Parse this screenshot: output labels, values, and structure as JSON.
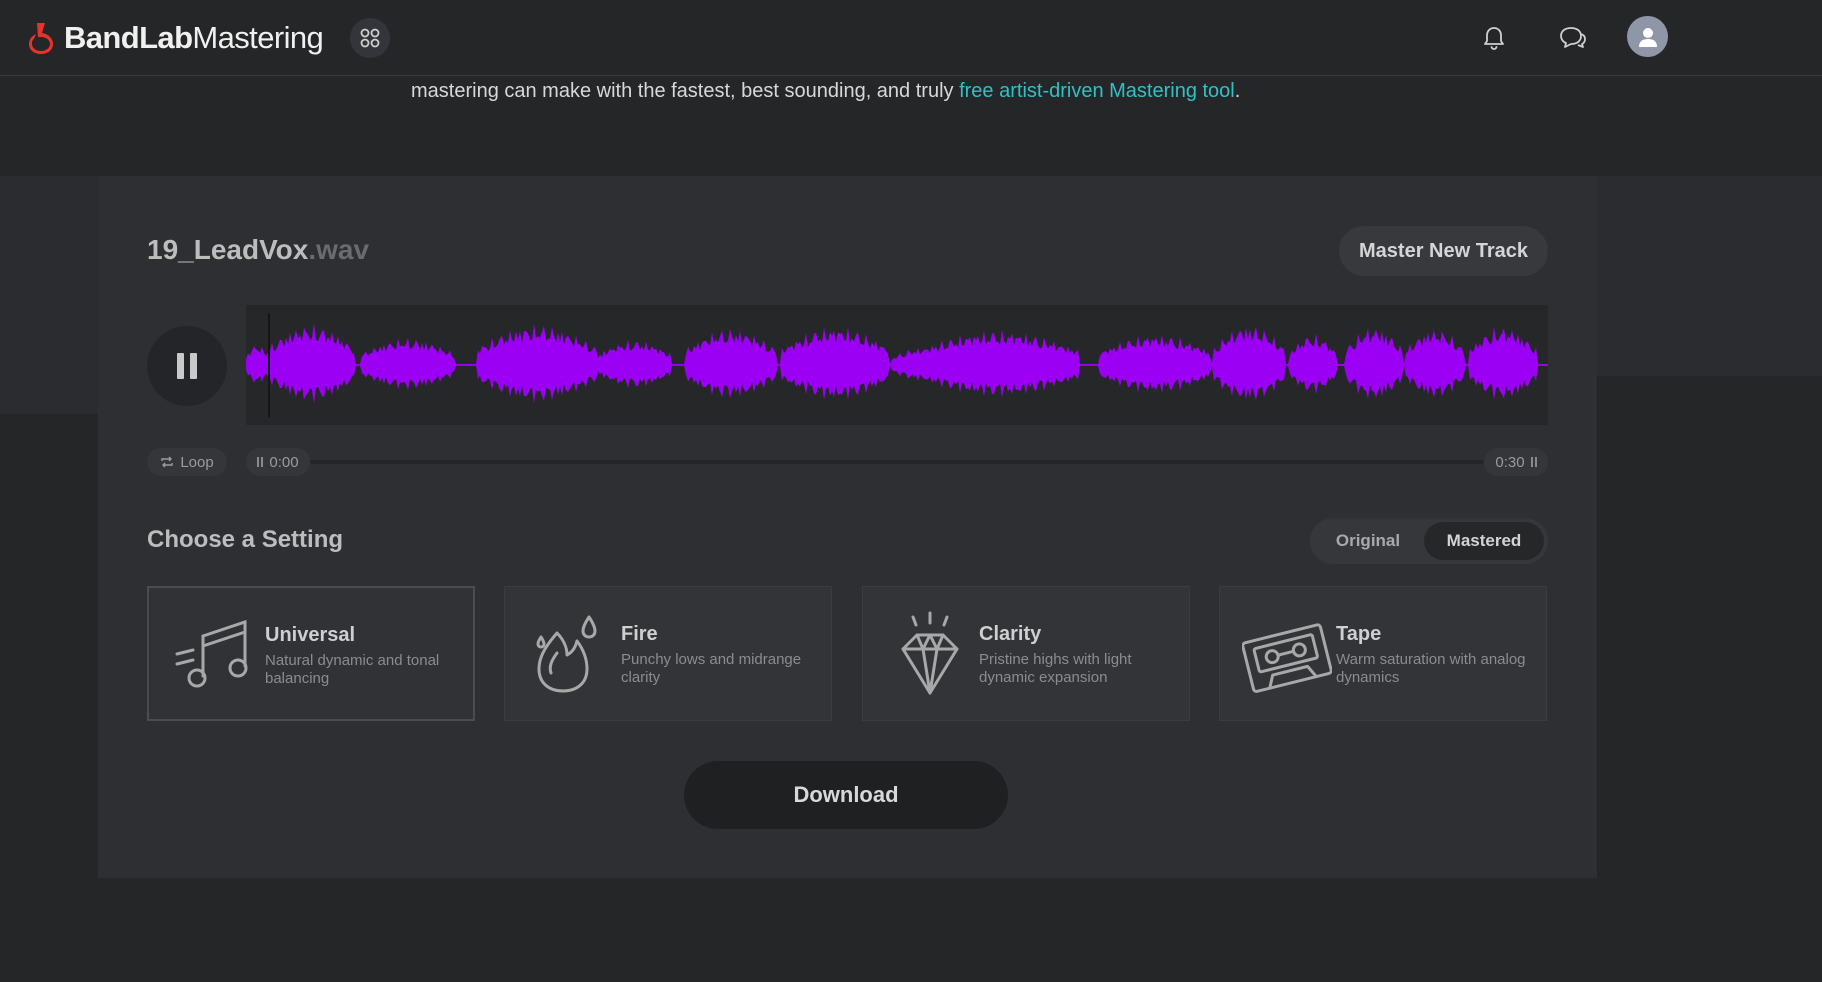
{
  "header": {
    "logo_brand": "BandLab",
    "logo_product": "Mastering",
    "apps_icon": "grid-apps-icon",
    "notifications_icon": "bell-icon",
    "messages_icon": "chat-bubbles-icon",
    "avatar_icon": "user-icon"
  },
  "intro": {
    "text_prefix": "mastering can make with the fastest, best sounding, and truly ",
    "link_text": "free artist-driven Mastering tool",
    "text_suffix": "."
  },
  "track": {
    "name": "19_LeadVox",
    "extension": ".wav",
    "master_new_label": "Master New Track",
    "waveform_color": "#9b00f5"
  },
  "player": {
    "state": "playing",
    "play_icon": "pause-icon",
    "loop_label": "Loop",
    "loop_icon": "loop-icon",
    "time_start": "0:00",
    "time_end": "0:30"
  },
  "settings": {
    "title": "Choose a Setting",
    "toggle_original": "Original",
    "toggle_mastered": "Mastered",
    "toggle_selected": "Mastered",
    "selected_preset": "Universal",
    "presets": [
      {
        "name": "Universal",
        "description": "Natural dynamic and tonal balancing",
        "icon": "music-notes-icon"
      },
      {
        "name": "Fire",
        "description": "Punchy lows and midrange clarity",
        "icon": "flame-icon"
      },
      {
        "name": "Clarity",
        "description": "Pristine highs with light dynamic expansion",
        "icon": "diamond-icon"
      },
      {
        "name": "Tape",
        "description": "Warm saturation with analog dynamics",
        "icon": "cassette-tape-icon"
      }
    ]
  },
  "actions": {
    "download_label": "Download"
  },
  "colors": {
    "background": "#252628",
    "panel": "#2e2f32",
    "accent_link": "#2fc1c7",
    "logo_red": "#e8322c"
  }
}
